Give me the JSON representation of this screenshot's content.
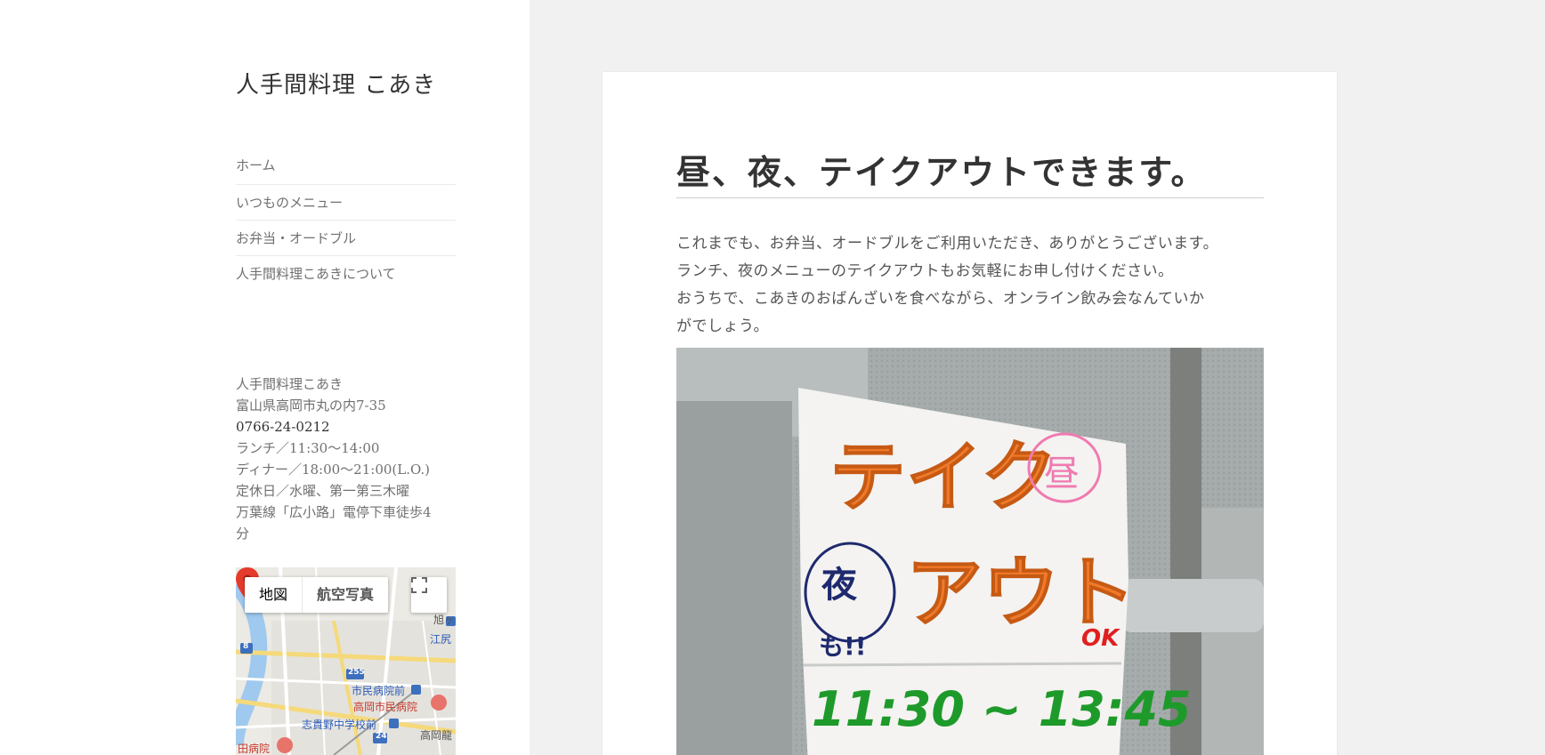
{
  "site": {
    "title": "人手間料理 こあき"
  },
  "nav": {
    "items": [
      {
        "label": "ホーム"
      },
      {
        "label": "いつものメニュー"
      },
      {
        "label": "お弁当・オードブル"
      },
      {
        "label": "人手間料理こあきについて"
      }
    ]
  },
  "info": {
    "name": "人手間料理こあき",
    "address": "富山県高岡市丸の内7-35",
    "phone": "0766-24-0212",
    "lunch": "ランチ／11:30～14:00",
    "dinner": "ディナー／18:00～21:00(L.O.)",
    "closed": "定休日／水曜、第一第三木曜",
    "access_1": "万葉線「広小路」電停下車徒歩4",
    "access_2": "分"
  },
  "map": {
    "type_map": "地図",
    "type_satellite": "航空写真",
    "labels": {
      "asahi": "旭ヶ",
      "ejiri": "江尻",
      "route_8": "8",
      "route_255": "255",
      "route_24": "24",
      "hospital_stop": "市民病院前",
      "hospital": "高岡市民病院",
      "school_stop": "志貴野中学校前",
      "takaoka": "高岡龍",
      "hospital_2": "田病院"
    }
  },
  "post": {
    "title": "昼、夜、テイクアウトできます。",
    "paragraphs": [
      "これまでも、お弁当、オードブルをご利用いただき、ありがとうございます。",
      "ランチ、夜のメニューのテイクアウトもお気軽にお申し付けください。",
      "おうちで、こあきのおばんざいを食べながら、オンライン飲み会なんていか",
      "がでしょう。"
    ],
    "photo": {
      "sign_main_1": "テイク",
      "sign_main_2": "アウト",
      "sign_day": "昼",
      "sign_night_1": "夜",
      "sign_night_2": "も!!",
      "sign_ok": "OK",
      "sign_time": "11:30 ~ 13:45"
    }
  },
  "colors": {
    "background": "#f1f1f1",
    "sidebar": "#ffffff",
    "text": "#333333",
    "muted": "#707070",
    "sign_orange": "#f07a2a",
    "sign_pink": "#f07ab0",
    "sign_green": "#1e9a2a",
    "sign_navy": "#1e2a6e",
    "sign_red": "#e02020"
  }
}
